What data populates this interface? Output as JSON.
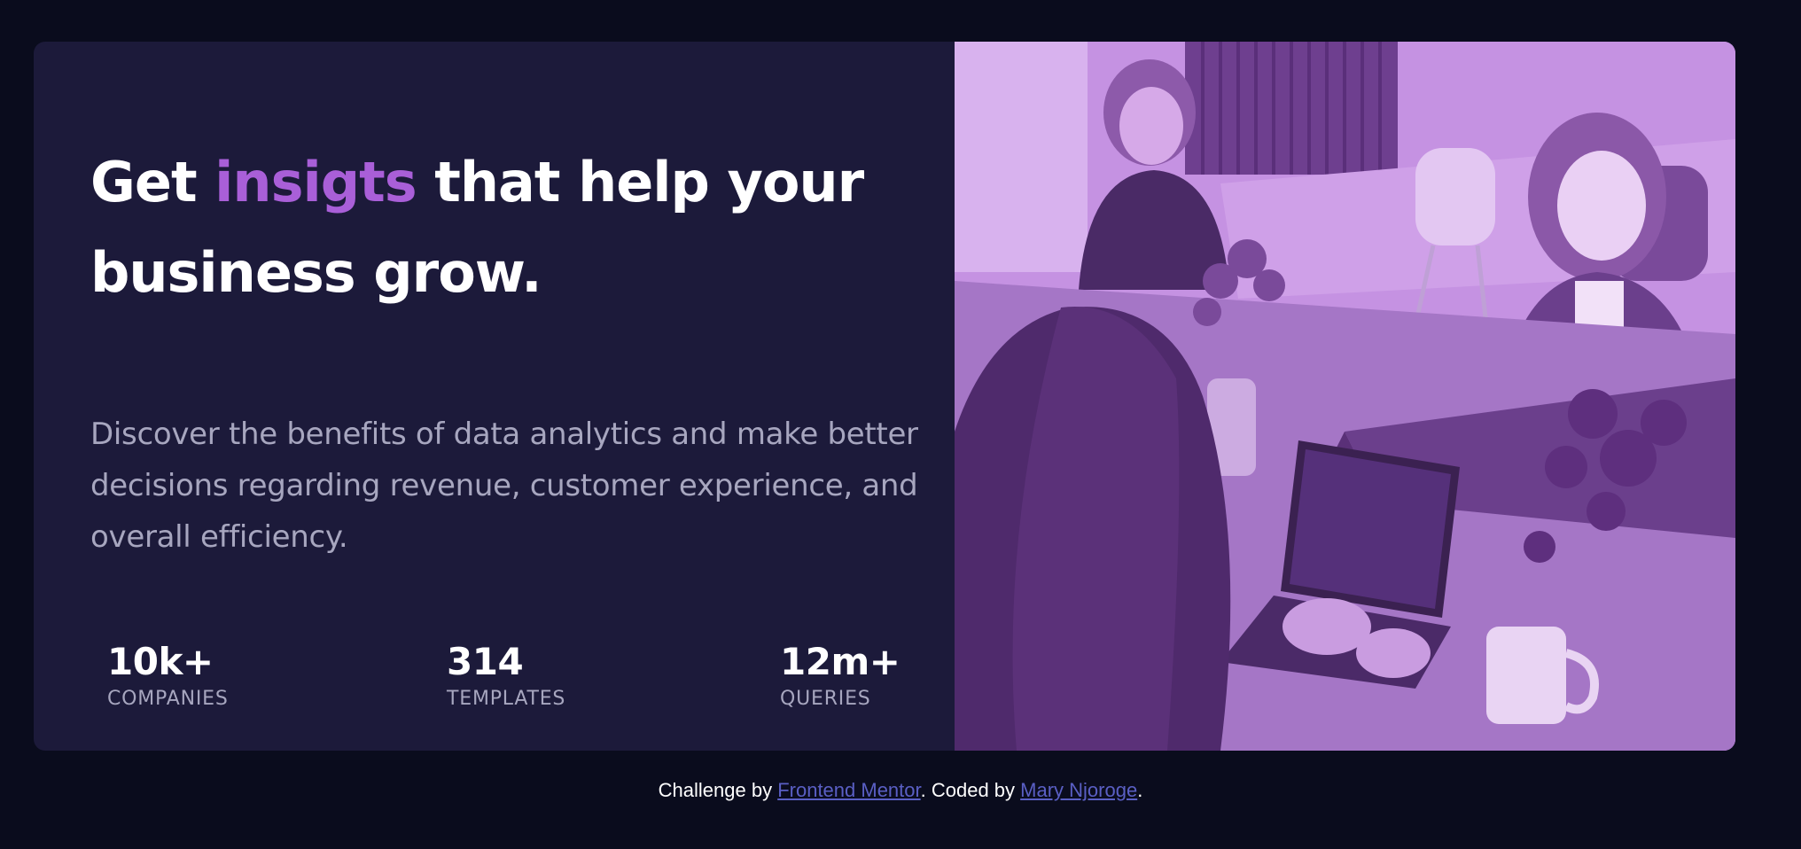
{
  "card": {
    "headline": {
      "before": "Get ",
      "accent": "insigts",
      "after": " that help your business grow."
    },
    "description": "Discover the benefits of data analytics and make better decisions regarding revenue, customer experience, and overall efficiency.",
    "stats": [
      {
        "value": "10k+",
        "label": "COMPANIES"
      },
      {
        "value": "314",
        "label": "TEMPLATES"
      },
      {
        "value": "12m+",
        "label": "QUERIES"
      }
    ]
  },
  "footer": {
    "prefix": "Challenge by ",
    "link1": "Frontend Mentor",
    "middle": ". Coded by ",
    "link2": "Mary Njoroge",
    "suffix": "."
  },
  "colors": {
    "page_background": "#0a0c1d",
    "card_background": "#1c1a3a",
    "accent": "#a95fd8",
    "muted_text": "#a7a6bf",
    "image_tint": "#a86fd0",
    "link": "#5a5fc4"
  }
}
